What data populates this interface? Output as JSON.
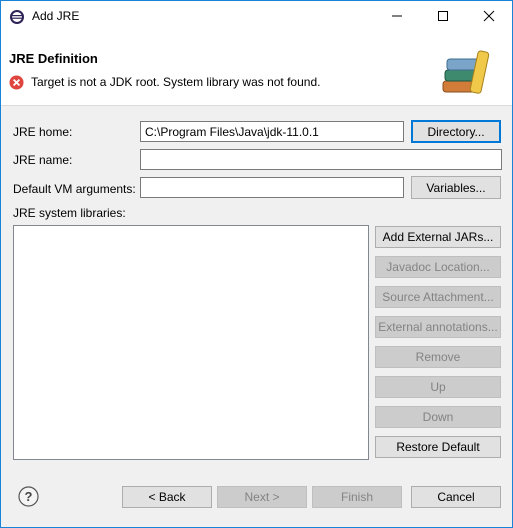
{
  "window": {
    "title": "Add JRE",
    "accent_color": "#1883d7"
  },
  "header": {
    "title": "JRE Definition",
    "error_message": "Target is not a JDK root. System library was not found.",
    "error_icon": "error-icon",
    "banner_icon": "books-icon"
  },
  "form": {
    "jre_home_label": "JRE home:",
    "jre_home_value": "C:\\Program Files\\Java\\jdk-11.0.1",
    "directory_button": "Directory...",
    "jre_name_label": "JRE name:",
    "jre_name_value": "",
    "vm_args_label": "Default VM arguments:",
    "vm_args_value": "",
    "variables_button": "Variables...",
    "libraries_label": "JRE system libraries:"
  },
  "library_buttons": {
    "add_external_jars": "Add External JARs...",
    "javadoc_location": "Javadoc Location...",
    "source_attachment": "Source Attachment...",
    "external_annotations": "External annotations...",
    "remove": "Remove",
    "up": "Up",
    "down": "Down",
    "restore_default": "Restore Default"
  },
  "footer": {
    "help_icon": "help-icon",
    "back": "< Back",
    "next": "Next >",
    "finish": "Finish",
    "cancel": "Cancel"
  }
}
